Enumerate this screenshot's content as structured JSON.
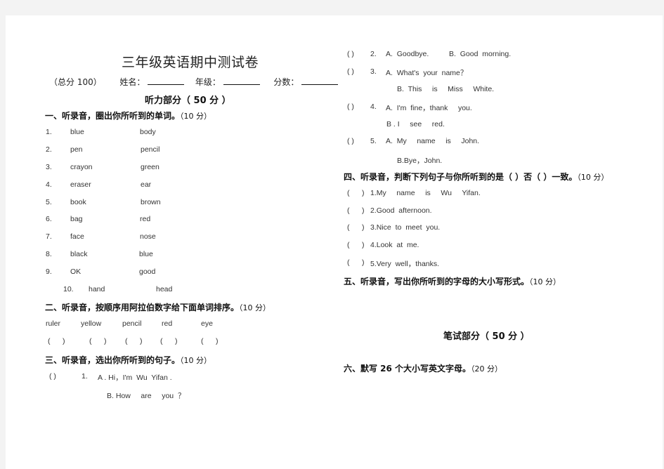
{
  "document": {
    "title": "三年级英语期中测试卷",
    "meta": {
      "total": "（总分 100）",
      "name_label": "姓名：",
      "grade_label": "年级：",
      "score_label": "分数："
    },
    "listening_part": "听力部分（ 50 分 ）",
    "writing_part": "笔试部分（ 50 分 ）"
  },
  "sections": {
    "s1": {
      "title": "一、听录音，圈出你所听到的单词。",
      "points": "（10 分）",
      "items": [
        {
          "num": "1.",
          "a": "blue",
          "b": "body"
        },
        {
          "num": "2.",
          "a": "pen",
          "b": "pencil"
        },
        {
          "num": "3.",
          "a": "crayon",
          "b": "green"
        },
        {
          "num": "4.",
          "a": "eraser",
          "b": "ear"
        },
        {
          "num": "5.",
          "a": "book",
          "b": "brown"
        },
        {
          "num": "6.",
          "a": "bag",
          "b": "red"
        },
        {
          "num": "7.",
          "a": "face",
          "b": "nose"
        },
        {
          "num": "8.",
          "a": "black",
          "b": "blue"
        },
        {
          "num": "9.",
          "a": "OK",
          "b": "good"
        },
        {
          "num": "10.",
          "a": "hand",
          "b": "head"
        }
      ]
    },
    "s2": {
      "title": "二、听录音，按顺序用阿拉伯数字给下面单词排序。",
      "points": "（10 分）",
      "words": [
        "ruler",
        "yellow",
        "pencil",
        "red",
        "eye"
      ],
      "blank": "(      )"
    },
    "s3": {
      "title": "三、听录音，选出你所听到的句子。",
      "points": "（10 分）",
      "paren": "(      )",
      "items": [
        {
          "num": "1.",
          "a": "A . Hi，I'm  Wu  Yifan .",
          "b": "B. How     are     you  ？"
        },
        {
          "num": "2.",
          "a": "A.  Goodbye.",
          "b": "B.  Good  morning."
        },
        {
          "num": "3.",
          "a": "A.  What's  your  name？",
          "b": "B.  This     is     Miss     White."
        },
        {
          "num": "4.",
          "a": "A.  I'm  fine，thank     you.",
          "b": "B . I     see     red."
        },
        {
          "num": "5.",
          "a": "A.  My     name     is     John.",
          "b": "B.Bye，John."
        }
      ]
    },
    "s4": {
      "title": "四、听录音，判断下列句子与你所听到的是（ ）否（ ）一致。",
      "points": "（10 分）",
      "paren": "(      )",
      "items": [
        "1.My     name     is     Wu     Yifan.",
        "2.Good  afternoon.",
        "3.Nice  to  meet  you.",
        "4.Look  at  me.",
        "5.Very  well，thanks."
      ]
    },
    "s5": {
      "title": "五、听录音，写出你所听到的字母的大小写形式。",
      "points": "（10 分）"
    },
    "s6": {
      "title": "六、默写 26 个大小写英文字母。",
      "points": "（20 分）"
    }
  }
}
